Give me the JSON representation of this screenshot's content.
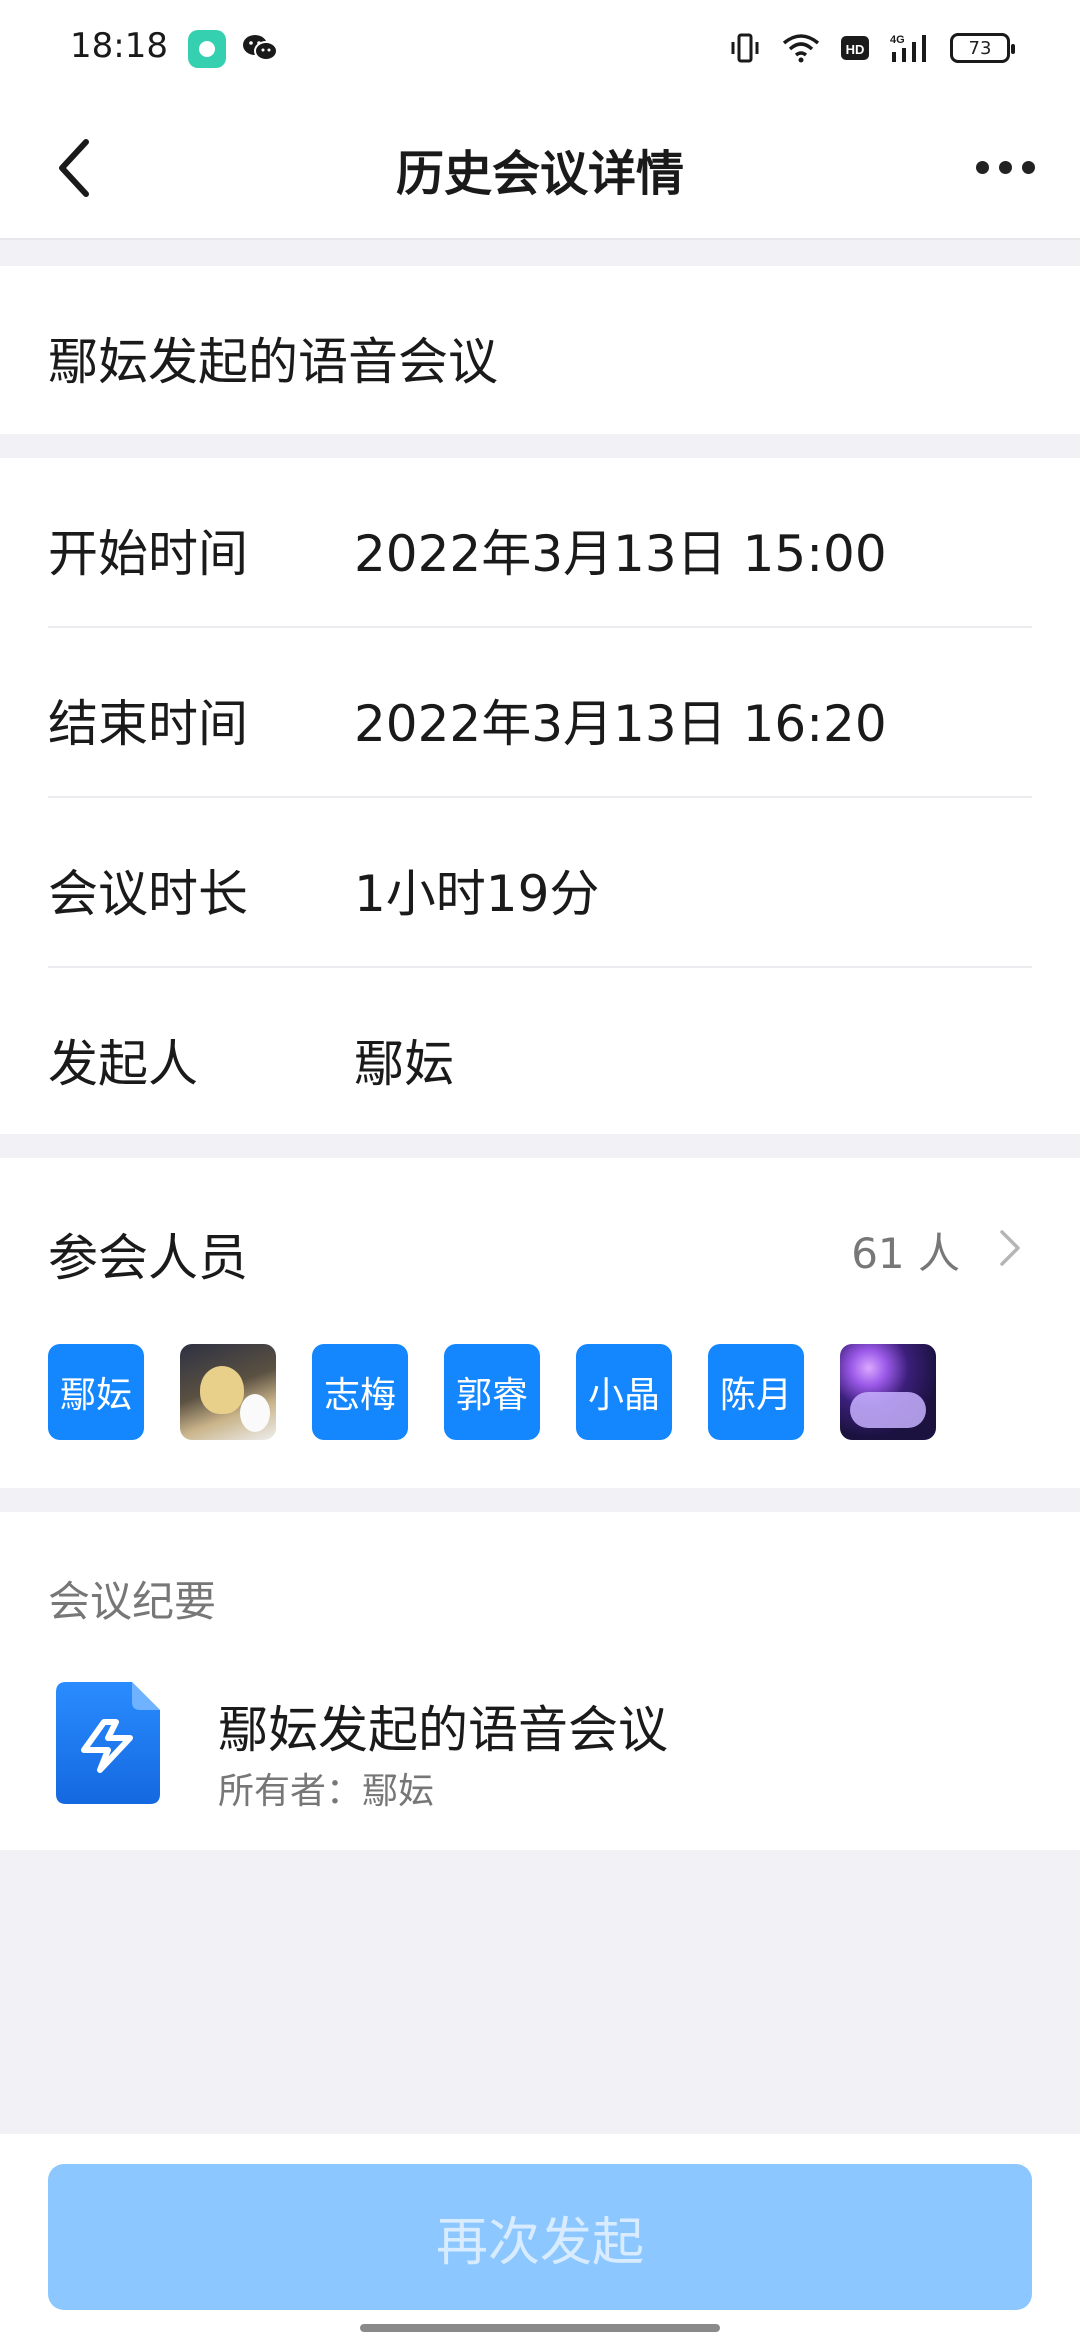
{
  "status_bar": {
    "time": "18:18",
    "battery": "73"
  },
  "nav": {
    "title": "历史会议详情"
  },
  "meeting": {
    "name": "鄢妘发起的语音会议"
  },
  "info": {
    "rows": [
      {
        "label": "开始时间",
        "value": "2022年3月13日 15:00"
      },
      {
        "label": "结束时间",
        "value": "2022年3月13日 16:20"
      },
      {
        "label": "会议时长",
        "value": "1小时19分"
      },
      {
        "label": "发起人",
        "value": "鄢妘"
      }
    ]
  },
  "members": {
    "label": "参会人员",
    "count": "61 人",
    "avatars": [
      {
        "text": "鄢妘"
      },
      {
        "text": ""
      },
      {
        "text": "志梅"
      },
      {
        "text": "郭睿"
      },
      {
        "text": "小晶"
      },
      {
        "text": "陈月"
      },
      {
        "text": ""
      }
    ]
  },
  "minutes": {
    "label": "会议纪要",
    "doc_title": "鄢妘发起的语音会议",
    "owner": "所有者：鄢妘"
  },
  "actions": {
    "restart_label": "再次发起"
  },
  "colors": {
    "accent": "#1487ff",
    "button_disabled": "#8cc8ff"
  }
}
